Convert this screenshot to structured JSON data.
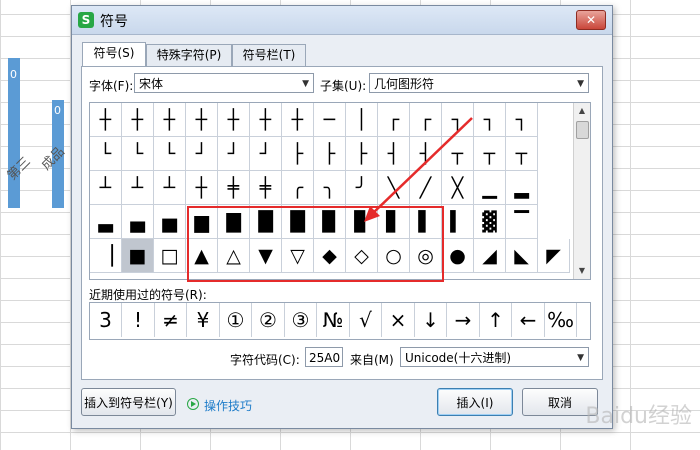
{
  "background": {
    "bar_labels": [
      "0",
      "0"
    ],
    "rotated_labels": [
      "第三",
      "成品"
    ]
  },
  "dialog": {
    "title": "符号",
    "close_glyph": "✕",
    "tabs": [
      {
        "label": "符号(S)",
        "active": true
      },
      {
        "label": "特殊字符(P)",
        "active": false
      },
      {
        "label": "符号栏(T)",
        "active": false
      }
    ],
    "font_label": "字体(F):",
    "font_value": "宋体",
    "subset_label": "子集(U):",
    "subset_value": "几何图形符",
    "symbols": [
      [
        "┼",
        "┼",
        "┼",
        "┼",
        "┼",
        "┼",
        "┼",
        "─",
        "│",
        "┌",
        "┌",
        "┐",
        "┐",
        "┐"
      ],
      [
        "└",
        "└",
        "└",
        "┘",
        "┘",
        "┘",
        "├",
        "├",
        "├",
        "┤",
        "┤",
        "┬",
        "┬",
        "┬"
      ],
      [
        "┴",
        "┴",
        "┴",
        "┼",
        "╪",
        "╪",
        "╭",
        "╮",
        "╯",
        "╲",
        "╱",
        "╳",
        "▁",
        "▂"
      ],
      [
        "▃",
        "▄",
        "▅",
        "▆",
        "▇",
        "█",
        "█",
        "▉",
        "▊",
        "▋",
        "▌",
        "▍",
        "▓",
        "▔"
      ],
      [
        "▕",
        "■",
        "□",
        "▲",
        "△",
        "▼",
        "▽",
        "◆",
        "◇",
        "○",
        "◎",
        "●",
        "◢",
        "◣",
        "◤"
      ]
    ],
    "selected_cell": "4-1",
    "recent_label": "近期使用过的符号(R):",
    "recent_symbols": [
      "3",
      "!",
      "≠",
      "¥",
      "①",
      "②",
      "③",
      "№",
      "√",
      "×",
      "↓",
      "→",
      "↑",
      "←",
      "‰"
    ],
    "char_code_label": "字符代码(C):",
    "char_code_value": "25A0",
    "from_label": "来自(M)",
    "from_value": "Unicode(十六进制)",
    "insert_to_bar_label": "插入到符号栏(Y)",
    "tips_link": "操作技巧",
    "insert_label": "插入(I)",
    "cancel_label": "取消"
  },
  "watermark": "Baidu经验",
  "colors": {
    "annotation": "#e52b2b",
    "link": "#1e7cc9",
    "brand": "#28a745"
  }
}
